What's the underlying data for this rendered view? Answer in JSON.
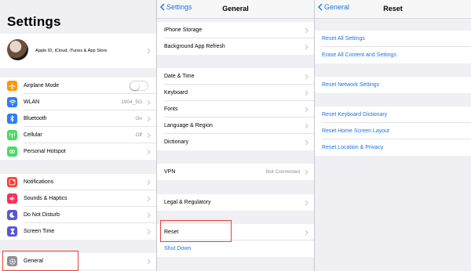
{
  "colors": {
    "accent": "#1a73e8",
    "highlight": "#e8413c",
    "orange": "#ff9500",
    "blue": "#2f7bf6",
    "green": "#4cd964",
    "red": "#ff3b30",
    "pink": "#ff2d55",
    "purple": "#5856d6",
    "gray": "#8e8e93"
  },
  "settings": {
    "title": "Settings",
    "profile_subtitle": "Apple ID, iCloud, iTunes & App Store",
    "connectivity": [
      {
        "label": "Airplane Mode",
        "icon": "airplane-icon",
        "toggle": false
      },
      {
        "label": "WLAN",
        "icon": "wifi-icon",
        "value": "1904_5G"
      },
      {
        "label": "Bluetooth",
        "icon": "bluetooth-icon",
        "value": "On"
      },
      {
        "label": "Cellular",
        "icon": "cellular-icon",
        "value": "Off"
      },
      {
        "label": "Personal Hotspot",
        "icon": "hotspot-icon"
      }
    ],
    "notifications_group": [
      {
        "label": "Notifications",
        "icon": "notifications-icon"
      },
      {
        "label": "Sounds & Haptics",
        "icon": "speaker-icon"
      },
      {
        "label": "Do Not Disturb",
        "icon": "moon-icon"
      },
      {
        "label": "Screen Time",
        "icon": "hourglass-icon"
      }
    ],
    "general_label": "General"
  },
  "general": {
    "back_label": "Settings",
    "title": "General",
    "group1": [
      "iPhone Storage",
      "Background App Refresh"
    ],
    "group2": [
      "Date & Time",
      "Keyboard",
      "Fonts",
      "Language & Region",
      "Dictionary"
    ],
    "vpn": {
      "label": "VPN",
      "value": "Not Connected"
    },
    "legal": "Legal & Regulatory",
    "reset": "Reset",
    "shutdown": "Shut Down"
  },
  "reset": {
    "back_label": "General",
    "title": "Reset",
    "group1": [
      "Reset All Settings",
      "Erase All Content and Settings"
    ],
    "group2": [
      "Reset Network Settings"
    ],
    "group3": [
      "Reset Keyboard Dictionary",
      "Reset Home Screen Layout",
      "Reset Location & Privacy"
    ]
  }
}
